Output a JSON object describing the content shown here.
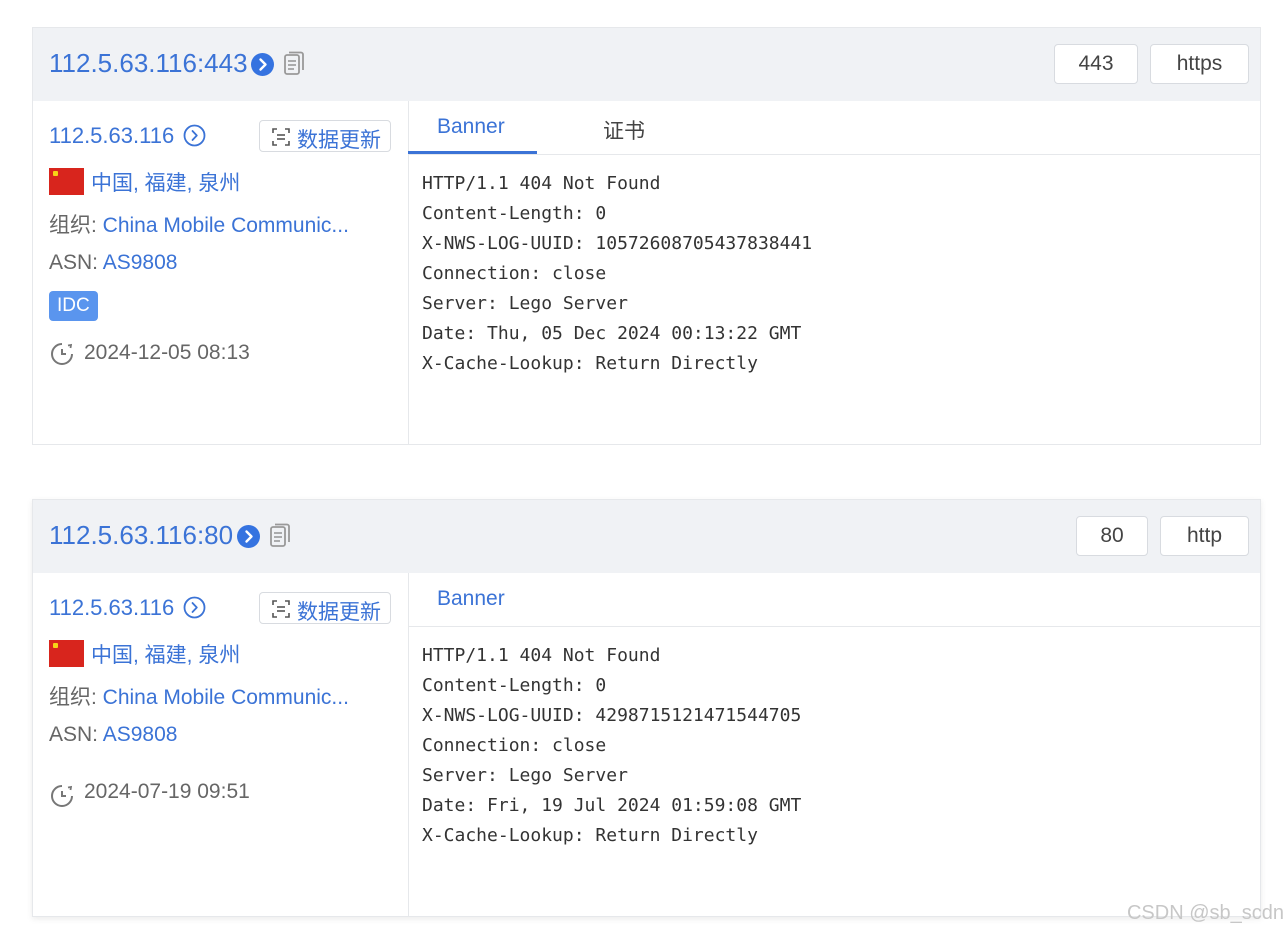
{
  "results": [
    {
      "host": "112.5.63.116:443",
      "port_tag": "443",
      "protocol_tag": "https",
      "ip": "112.5.63.116",
      "update_button": "数据更新",
      "location": "中国, 福建, 泉州",
      "org_label": "组织: ",
      "org_value": "China Mobile Communic...",
      "asn_label": "ASN: ",
      "asn_value": "AS9808",
      "badge": "IDC",
      "time": "2024-12-05 08:13",
      "tabs": [
        "Banner",
        "证书"
      ],
      "banner_lines": [
        "HTTP/1.1 404 Not Found",
        "Content-Length: 0",
        "X-NWS-LOG-UUID: 10572608705437838441",
        "Connection: close",
        "Server: Lego Server",
        "Date: Thu, 05 Dec 2024 00:13:22 GMT",
        "X-Cache-Lookup: Return Directly"
      ]
    },
    {
      "host": "112.5.63.116:80",
      "port_tag": "80",
      "protocol_tag": "http",
      "ip": "112.5.63.116",
      "update_button": "数据更新",
      "location": "中国, 福建, 泉州",
      "org_label": "组织: ",
      "org_value": "China Mobile Communic...",
      "asn_label": "ASN: ",
      "asn_value": "AS9808",
      "time": "2024-07-19 09:51",
      "tabs": [
        "Banner"
      ],
      "banner_lines": [
        "HTTP/1.1 404 Not Found",
        "Content-Length: 0",
        "X-NWS-LOG-UUID: 4298715121471544705",
        "Connection: close",
        "Server: Lego Server",
        "Date: Fri, 19 Jul 2024 01:59:08 GMT",
        "X-Cache-Lookup: Return Directly"
      ]
    }
  ],
  "watermark": "CSDN @sb_scdn",
  "colors": {
    "accent": "#3b73d6",
    "header_bg": "#f0f2f5",
    "badge_bg": "#5a95ee",
    "flag_red": "#d8251d"
  },
  "icons": [
    "chevron-circle-right-icon",
    "copy-icon",
    "scan-icon",
    "china-flag-icon",
    "clock-icon"
  ]
}
